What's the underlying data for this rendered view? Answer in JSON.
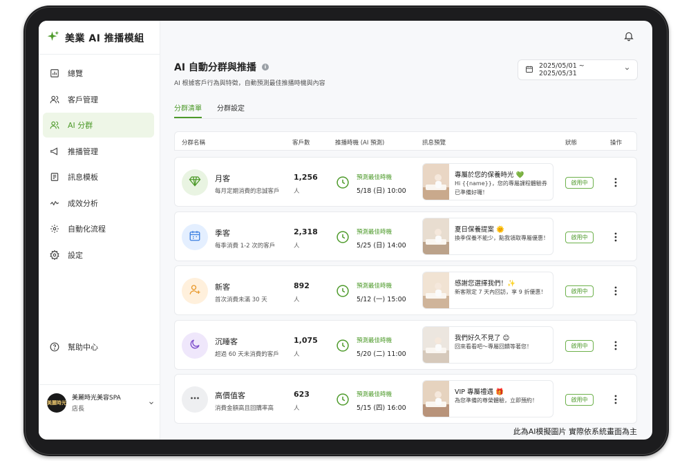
{
  "app": {
    "title": "美業 AI 推播模組"
  },
  "sidebar": {
    "items": [
      {
        "label": "總覽",
        "icon": "dashboard-icon"
      },
      {
        "label": "客戶管理",
        "icon": "users-icon"
      },
      {
        "label": "AI 分群",
        "icon": "users-icon",
        "active": true
      },
      {
        "label": "推播管理",
        "icon": "megaphone-icon"
      },
      {
        "label": "訊息模板",
        "icon": "template-icon"
      },
      {
        "label": "成效分析",
        "icon": "analytics-icon"
      },
      {
        "label": "自動化流程",
        "icon": "automation-icon"
      },
      {
        "label": "設定",
        "icon": "gear-icon"
      }
    ],
    "help_label": "幫助中心",
    "profile": {
      "name": "美麗時光美容SPA",
      "role": "店長",
      "avatar_text": "美麗時光"
    }
  },
  "header": {
    "title": "AI 自動分群與推播",
    "subtitle": "AI 根據客戶行為與特徵，自動預測最佳推播時機與內容",
    "date_range": "2025/05/01 ~ 2025/05/31"
  },
  "tabs": [
    {
      "label": "分群清單",
      "active": true
    },
    {
      "label": "分群設定"
    }
  ],
  "table": {
    "columns": [
      "分群名稱",
      "客戶數",
      "推播時機 (AI 預測)",
      "訊息預覽",
      "狀態",
      "操作"
    ],
    "time_label": "預測最佳時機",
    "rows": [
      {
        "name": "月客",
        "desc": "每月定期消費的忠誠客戶",
        "count": "1,256",
        "unit": "人",
        "time": "5/18 (日) 10:00",
        "preview_title": "專屬於您的保養時光 💚",
        "preview_body": "Hi {{name}}，您的專屬課程體驗券已準備好囉！",
        "status": "啟用中",
        "icon": "diamond-icon",
        "color": "#e9f4e2",
        "icolor": "#4d9a2a"
      },
      {
        "name": "季客",
        "desc": "每季消費 1-2 次的客戶",
        "count": "2,318",
        "unit": "人",
        "time": "5/25 (日) 14:00",
        "preview_title": "夏日保養提案 🌞",
        "preview_body": "換季保養不能少，點我領取專屬優惠！",
        "status": "啟用中",
        "icon": "calendar-icon",
        "color": "#e4efff",
        "icolor": "#3b7fe0"
      },
      {
        "name": "新客",
        "desc": "首次消費未滿 30 天",
        "count": "892",
        "unit": "人",
        "time": "5/12 (一) 15:00",
        "preview_title": "感謝您選擇我們！✨",
        "preview_body": "新客限定 7 天內回訪，享 9 折優惠！",
        "status": "啟用中",
        "icon": "user-plus-icon",
        "color": "#fff0dc",
        "icolor": "#e8982b"
      },
      {
        "name": "沉睡客",
        "desc": "超過 60 天未消費的客戶",
        "count": "1,075",
        "unit": "人",
        "time": "5/20 (二) 11:00",
        "preview_title": "我們好久不見了 😊",
        "preview_body": "回來看看吧～專屬回饋等著您！",
        "status": "啟用中",
        "icon": "moon-icon",
        "color": "#efe7fb",
        "icolor": "#7c4dcc"
      },
      {
        "name": "高價值客",
        "desc": "消費金額高且回購率高",
        "count": "623",
        "unit": "人",
        "time": "5/15 (四) 16:00",
        "preview_title": "VIP 專屬禮遇 🎁",
        "preview_body": "為您準備的尊榮體驗，立即預約！",
        "status": "啟用中",
        "icon": "dots-icon",
        "color": "#eeeff1",
        "icolor": "#444444"
      }
    ]
  },
  "disclaimer": "此為AI模擬圖片 實際依系統畫面為主",
  "colors": {
    "accent": "#4d9a2a",
    "accent_bg": "#eef6e7"
  }
}
